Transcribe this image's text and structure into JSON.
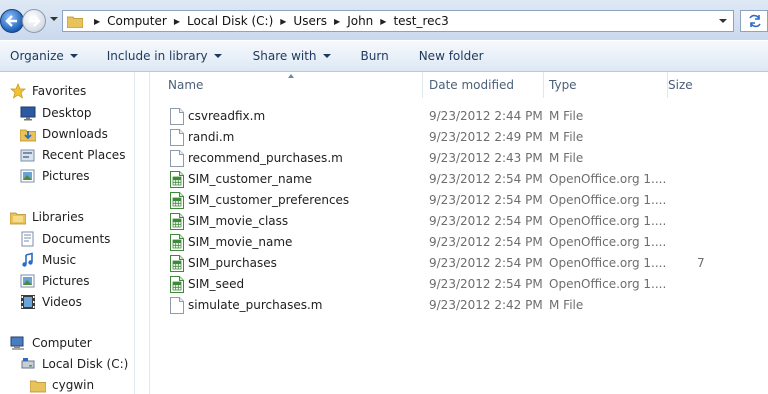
{
  "address_bar": {
    "crumbs": [
      "Computer",
      "Local Disk (C:)",
      "Users",
      "John",
      "test_rec3"
    ]
  },
  "toolbar": {
    "organize": "Organize",
    "include_in_library": "Include in library",
    "share_with": "Share with",
    "burn": "Burn",
    "new_folder": "New folder"
  },
  "nav": {
    "favorites": "Favorites",
    "desktop": "Desktop",
    "downloads": "Downloads",
    "recent_places": "Recent Places",
    "pictures": "Pictures",
    "libraries": "Libraries",
    "documents": "Documents",
    "music": "Music",
    "lib_pictures": "Pictures",
    "videos": "Videos",
    "computer": "Computer",
    "local_disk": "Local Disk (C:)",
    "cygwin": "cygwin"
  },
  "columns": {
    "name": "Name",
    "date_modified": "Date modified",
    "type": "Type",
    "size": "Size"
  },
  "files": [
    {
      "name": "csvreadfix.m",
      "date": "9/23/2012 2:44 PM",
      "type": "M File",
      "size": "",
      "icon": "document-icon"
    },
    {
      "name": "randi.m",
      "date": "9/23/2012 2:49 PM",
      "type": "M File",
      "size": "",
      "icon": "document-icon"
    },
    {
      "name": "recommend_purchases.m",
      "date": "9/23/2012 2:43 PM",
      "type": "M File",
      "size": "",
      "icon": "document-icon"
    },
    {
      "name": "SIM_customer_name",
      "date": "9/23/2012 2:54 PM",
      "type": "OpenOffice.org 1....",
      "size": "",
      "icon": "spreadsheet-icon"
    },
    {
      "name": "SIM_customer_preferences",
      "date": "9/23/2012 2:54 PM",
      "type": "OpenOffice.org 1....",
      "size": "",
      "icon": "spreadsheet-icon"
    },
    {
      "name": "SIM_movie_class",
      "date": "9/23/2012 2:54 PM",
      "type": "OpenOffice.org 1....",
      "size": "",
      "icon": "spreadsheet-icon"
    },
    {
      "name": "SIM_movie_name",
      "date": "9/23/2012 2:54 PM",
      "type": "OpenOffice.org 1....",
      "size": "",
      "icon": "spreadsheet-icon"
    },
    {
      "name": "SIM_purchases",
      "date": "9/23/2012 2:54 PM",
      "type": "OpenOffice.org 1....",
      "size": "7",
      "icon": "spreadsheet-icon"
    },
    {
      "name": "SIM_seed",
      "date": "9/23/2012 2:54 PM",
      "type": "OpenOffice.org 1....",
      "size": "",
      "icon": "spreadsheet-icon"
    },
    {
      "name": "simulate_purchases.m",
      "date": "9/23/2012 2:42 PM",
      "type": "M File",
      "size": "",
      "icon": "document-icon"
    }
  ],
  "colors": {
    "toolbar_text": "#1e395b",
    "header_text": "#4c607a",
    "meta_text": "#6d6d6d",
    "address_bar_bg": "#c9d9ee"
  }
}
